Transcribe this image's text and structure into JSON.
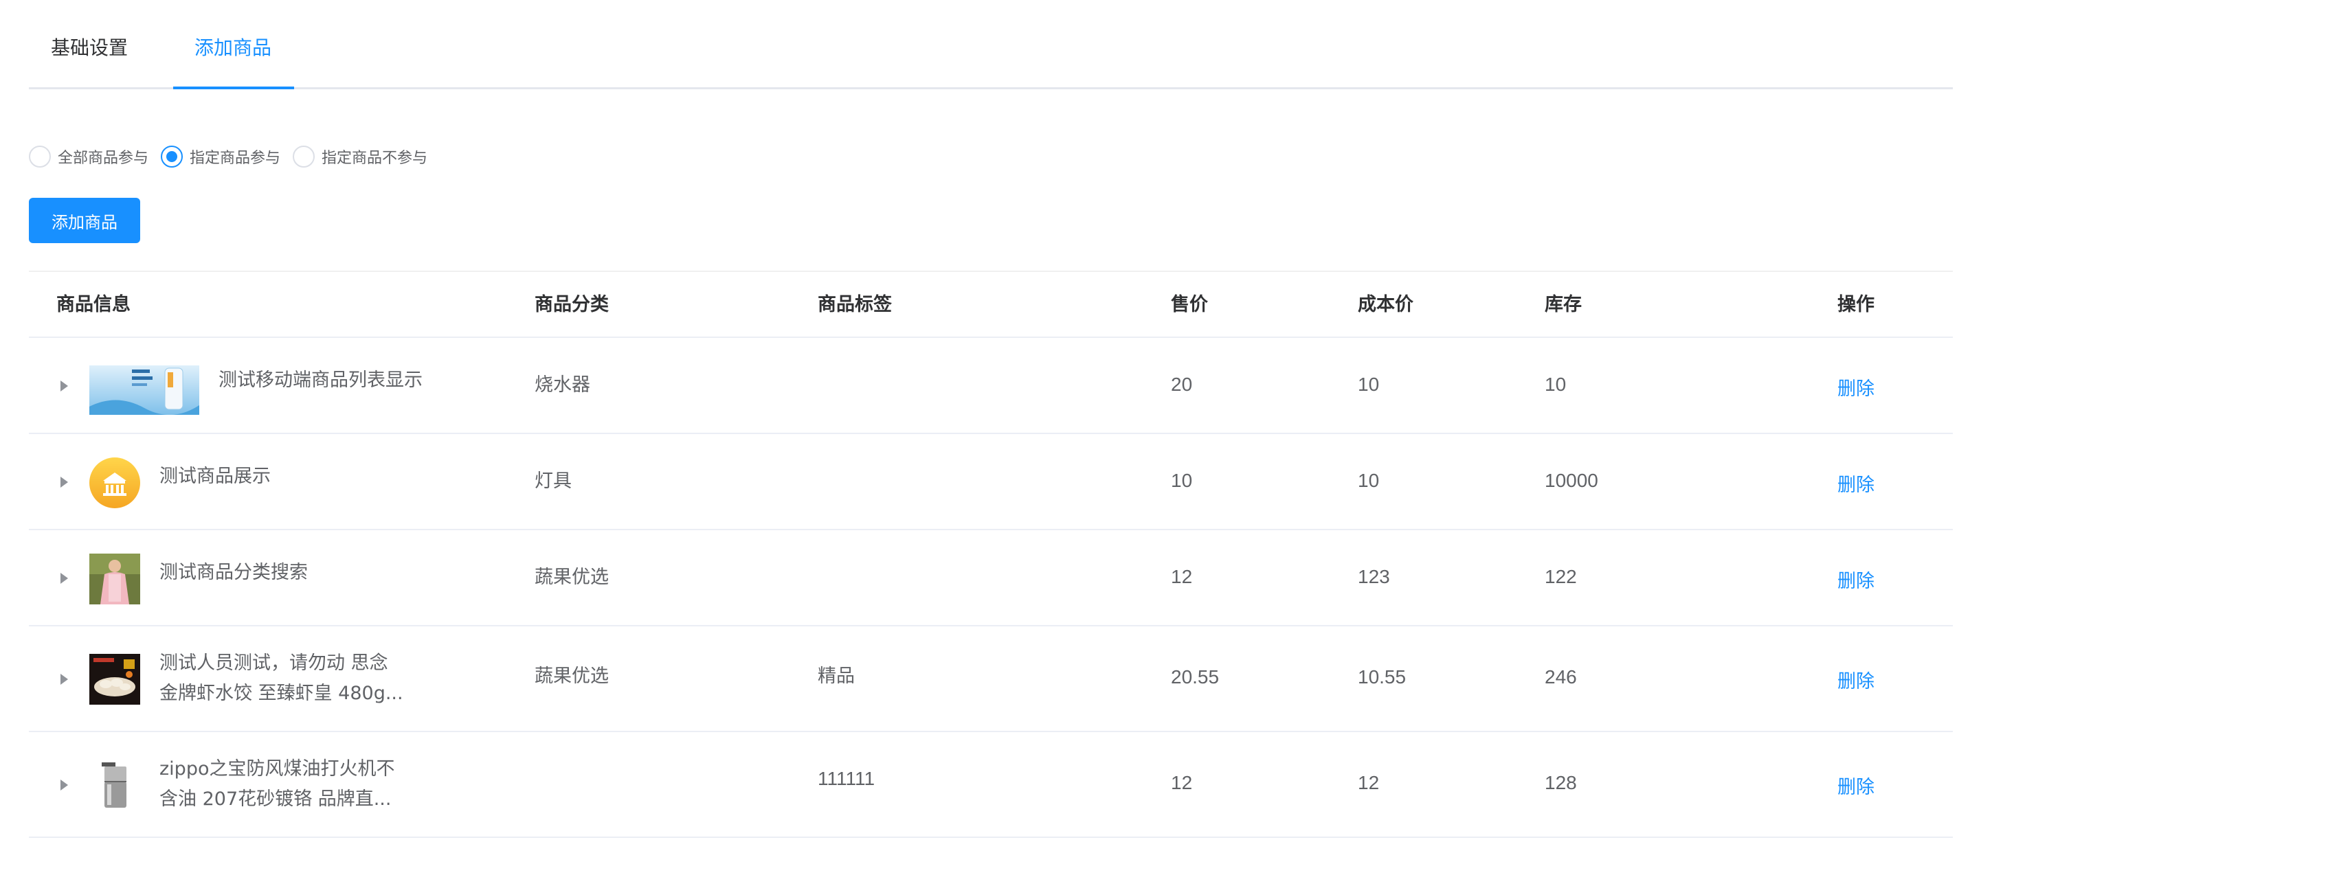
{
  "tabs": [
    {
      "label": "基础设置",
      "active": false
    },
    {
      "label": "添加商品",
      "active": true
    }
  ],
  "radios": [
    {
      "label": "全部商品参与",
      "checked": false
    },
    {
      "label": "指定商品参与",
      "checked": true
    },
    {
      "label": "指定商品不参与",
      "checked": false
    }
  ],
  "add_button": "添加商品",
  "accent_color": "#1890ff",
  "table": {
    "headers": {
      "info": "商品信息",
      "category": "商品分类",
      "tag": "商品标签",
      "price": "售价",
      "cost": "成本价",
      "stock": "库存",
      "action": "操作"
    },
    "rows": [
      {
        "name_line1": "测试移动端商品列表显示",
        "name_line2": "",
        "category": "烧水器",
        "tag": "",
        "price": "20",
        "cost": "10",
        "stock": "10",
        "action": "删除",
        "thumb": "water-bottle-banner"
      },
      {
        "name_line1": "测试商品展示",
        "name_line2": "",
        "category": "灯具",
        "tag": "",
        "price": "10",
        "cost": "10",
        "stock": "10000",
        "action": "删除",
        "thumb": "yellow-circle-building-logo"
      },
      {
        "name_line1": "测试商品分类搜索",
        "name_line2": "",
        "category": "蔬果优选",
        "tag": "",
        "price": "12",
        "cost": "123",
        "stock": "122",
        "action": "删除",
        "thumb": "person-photo"
      },
      {
        "name_line1": "测试人员测试，请勿动 思念",
        "name_line2": "金牌虾水饺 至臻虾皇 480g...",
        "category": "蔬果优选",
        "tag": "精品",
        "price": "20.55",
        "cost": "10.55",
        "stock": "246",
        "action": "删除",
        "thumb": "dumplings-photo"
      },
      {
        "name_line1": "zippo之宝防风煤油打火机不",
        "name_line2": "含油 207花砂镀铬 品牌直...",
        "category": "",
        "tag": "111111",
        "price": "12",
        "cost": "12",
        "stock": "128",
        "action": "删除",
        "thumb": "lighter-photo"
      }
    ]
  }
}
